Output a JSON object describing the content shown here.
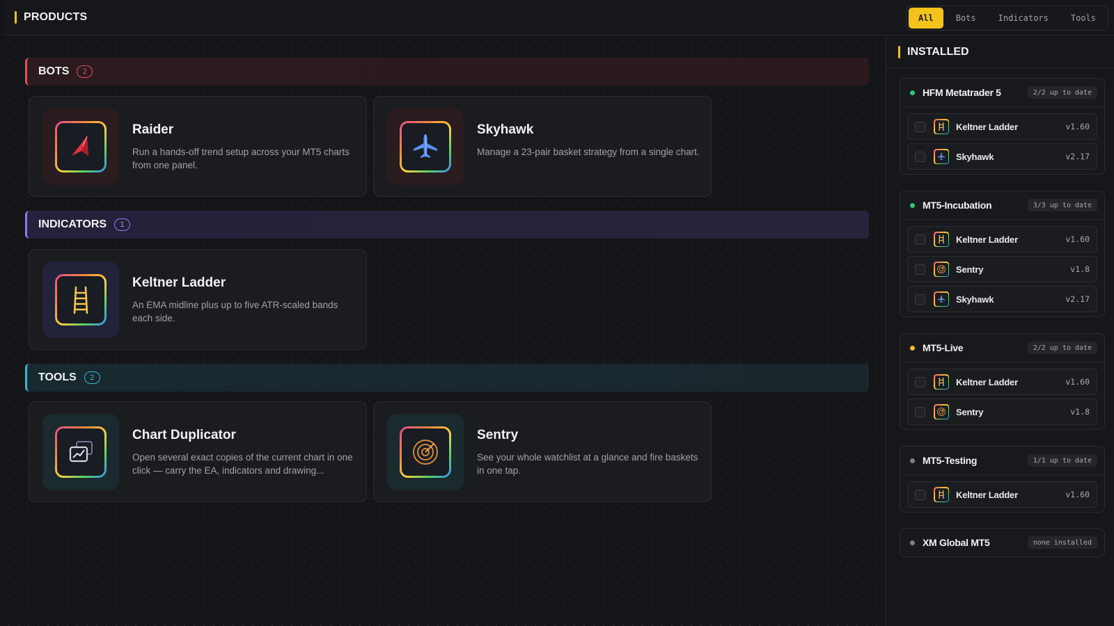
{
  "header": {
    "title": "PRODUCTS",
    "filters": [
      "All",
      "Bots",
      "Indicators",
      "Tools"
    ],
    "active_filter": "All"
  },
  "colors": {
    "accent": "#f3c31c",
    "bots": "#e0525a",
    "indicators": "#8b7cf6",
    "tools": "#3ab8d4",
    "online": "#2fc67a",
    "warning": "#f3b92a",
    "offline": "#7d8089"
  },
  "sections": {
    "bots": {
      "title": "BOTS",
      "count": "2",
      "cards": [
        {
          "title": "Raider",
          "description": "Run a hands-off trend setup across your MT5 charts from one panel.",
          "icon": "raider-arrow-icon"
        },
        {
          "title": "Skyhawk",
          "description": "Manage a 23-pair basket strategy from a single chart.",
          "icon": "plane-icon"
        }
      ]
    },
    "indicators": {
      "title": "INDICATORS",
      "count": "1",
      "cards": [
        {
          "title": "Keltner Ladder",
          "description": "An EMA midline plus up to five ATR-scaled bands each side.",
          "icon": "ladder-icon"
        }
      ]
    },
    "tools": {
      "title": "TOOLS",
      "count": "2",
      "cards": [
        {
          "title": "Chart Duplicator",
          "description": "Open several exact copies of the current chart in one click — carry the EA, indicators and drawing...",
          "icon": "chart-copy-icon"
        },
        {
          "title": "Sentry",
          "description": "See your whole watchlist at a glance and fire baskets in one tap.",
          "icon": "radar-icon"
        }
      ]
    }
  },
  "installed": {
    "title": "INSTALLED",
    "groups": [
      {
        "name": "HFM Metatrader 5",
        "status": "2/2 up to date",
        "dot": "online",
        "items": [
          {
            "name": "Keltner Ladder",
            "version": "v1.60",
            "icon": "ladder-icon"
          },
          {
            "name": "Skyhawk",
            "version": "v2.17",
            "icon": "plane-icon"
          }
        ]
      },
      {
        "name": "MT5-Incubation",
        "status": "3/3 up to date",
        "dot": "online",
        "items": [
          {
            "name": "Keltner Ladder",
            "version": "v1.60",
            "icon": "ladder-icon"
          },
          {
            "name": "Sentry",
            "version": "v1.8",
            "icon": "radar-icon"
          },
          {
            "name": "Skyhawk",
            "version": "v2.17",
            "icon": "plane-icon"
          }
        ]
      },
      {
        "name": "MT5-Live",
        "status": "2/2 up to date",
        "dot": "warning",
        "items": [
          {
            "name": "Keltner Ladder",
            "version": "v1.60",
            "icon": "ladder-icon"
          },
          {
            "name": "Sentry",
            "version": "v1.8",
            "icon": "radar-icon"
          }
        ]
      },
      {
        "name": "MT5-Testing",
        "status": "1/1 up to date",
        "dot": "offline",
        "items": [
          {
            "name": "Keltner Ladder",
            "version": "v1.60",
            "icon": "ladder-icon"
          }
        ]
      },
      {
        "name": "XM Global MT5",
        "status": "none installed",
        "dot": "offline",
        "items": []
      }
    ]
  }
}
